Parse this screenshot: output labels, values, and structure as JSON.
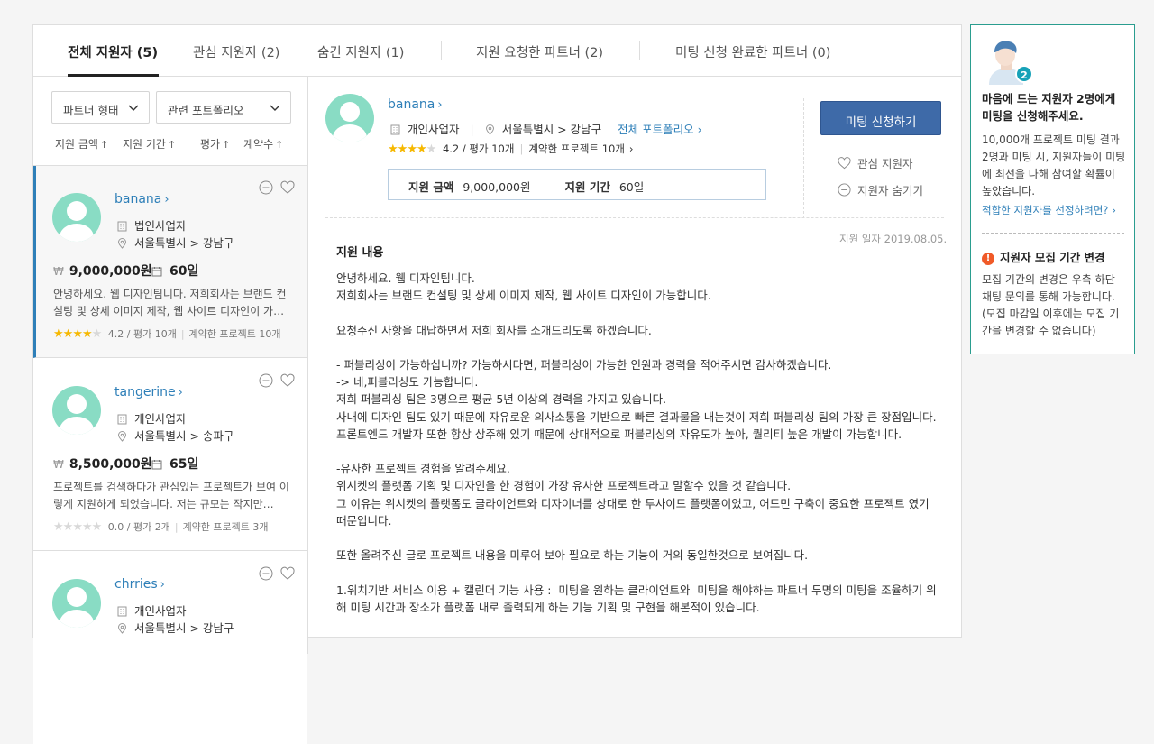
{
  "tabs": [
    {
      "label": "전체 지원자 (5)"
    },
    {
      "label": "관심 지원자 (2)"
    },
    {
      "label": "숨긴 지원자 (1)"
    },
    {
      "label": "지원 요청한 파트너 (2)"
    },
    {
      "label": "미팅 신청 완료한 파트너 (0)"
    }
  ],
  "filters": {
    "partner_type": "파트너 형태",
    "portfolio": "관련 포트폴리오"
  },
  "sort": [
    {
      "label": "지원 금액"
    },
    {
      "label": "지원 기간"
    },
    {
      "label": "평가"
    },
    {
      "label": "계약수"
    }
  ],
  "sort_arrow": "↑",
  "cards": [
    {
      "name": "banana",
      "type": "법인사업자",
      "location": "서울특별시 > 강남구",
      "price": "9,000,000원",
      "period": "60일",
      "desc": "안녕하세요. 웹 디자인팀니다. 저희회사는 브랜드 컨설팅 및 상세 이미지 제작, 웹 사이트 디자인이 가…",
      "stars_on": 4,
      "rating": "4.2 / 평가 10개",
      "contracts": "계약한 프로젝트 10개"
    },
    {
      "name": "tangerine",
      "type": "개인사업자",
      "location": "서울특별시 > 송파구",
      "price": "8,500,000원",
      "period": "65일",
      "desc": "프로젝트를 검색하다가 관심있는 프로젝트가 보여 이렇게 지원하게 되었습니다. 저는 규모는 작지만…",
      "stars_on": 0,
      "rating": "0.0 / 평가 2개",
      "contracts": "계약한 프로젝트 3개"
    },
    {
      "name": "chrries",
      "type": "개인사업자",
      "location": "서울특별시 > 강남구"
    }
  ],
  "currency_symbol": "₩",
  "detail": {
    "name": "banana",
    "type": "개인사업자",
    "location": "서울특별시 > 강남구",
    "portfolio_link": "전체 포트폴리오",
    "rating": "4.2 / 평가 10개",
    "contracts": "계약한 프로젝트 10개",
    "amount_label": "지원 금액",
    "amount": "9,000,000원",
    "period_label": "지원 기간",
    "period": "60일",
    "meet_button": "미팅 신청하기",
    "interest": "관심 지원자",
    "hide": "지원자 숨기기",
    "date": "지원 일자 2019.08.05.",
    "section_title": "지원 내용",
    "body": "안녕하세요. 웹 디자인팀니다.\n저희회사는 브랜드 컨설팅 및 상세 이미지 제작, 웹 사이트 디자인이 가능합니다.\n\n요청주신 사항을 대답하면서 저희 회사를 소개드리도록 하겠습니다.\n\n- 퍼블리싱이 가능하십니까? 가능하시다면, 퍼블리싱이 가능한 인원과 경력을 적어주시면 감사하겠습니다.\n-> 네,퍼블리싱도 가능합니다.\n저희 퍼블리싱 팀은 3명으로 평균 5년 이상의 경력을 가지고 있습니다.\n사내에 디자인 팀도 있기 때문에 자유로운 의사소통을 기반으로 빠른 결과물을 내는것이 저희 퍼블리싱 팀의 가장 큰 장점입니다.\n프론트엔드 개발자 또한 항상 상주해 있기 때문에 상대적으로 퍼블리싱의 자유도가 높아, 퀄리티 높은 개발이 가능합니다.\n\n-유사한 프로젝트 경험을 알려주세요.\n위시켓의 플랫폼 기획 및 디자인을 한 경험이 가장 유사한 프로젝트라고 말할수 있을 것 같습니다.\n그 이유는 위시켓의 플랫폼도 클라이언트와 디자이너를 상대로 한 투사이드 플랫폼이었고, 어드민 구축이 중요한 프로젝트 였기 때문입니다.\n\n또한 올려주신 글로 프로젝트 내용을 미루어 보아 필요로 하는 기능이 거의 동일한것으로 보여집니다.\n\n1.위치기반 서비스 이용 + 캘린더 기능 사용 :  미팅을 원하는 클라이언트와  미팅을 해야하는 파트너 두명의 미팅을 조율하기 위해 미팅 시간과 장소가 플랫폼 내로 출력되게 하는 기능 기획 및 구현을 해본적이 있습니다."
  },
  "aside": {
    "badge": "2",
    "headline": "마음에 드는 지원자 2명에게 미팅을 신청해주세요.",
    "text": "10,000개 프로젝트 미팅 결과 2명과 미팅 시, 지원자들이 미팅에 최선을 다해 참여할 확률이 높았습니다.",
    "link": "적합한 지원자를 선정하려면?",
    "warn_title": "지원자 모집 기간 변경",
    "warn_text": "모집 기간의 변경은 우측 하단 채팅 문의를 통해 가능합니다. (모집 마감일 이후에는 모집 기간을 변경할 수 없습니다)"
  }
}
